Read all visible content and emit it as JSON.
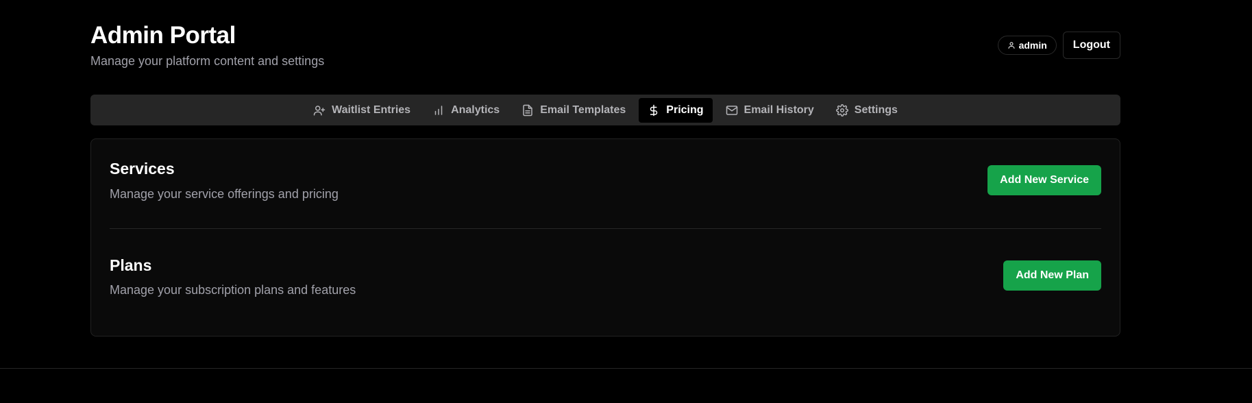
{
  "header": {
    "title": "Admin Portal",
    "subtitle": "Manage your platform content and settings",
    "user_label": "admin",
    "logout_label": "Logout"
  },
  "tabs": [
    {
      "label": "Waitlist Entries",
      "icon": "user-plus-icon",
      "active": false
    },
    {
      "label": "Analytics",
      "icon": "bar-chart-icon",
      "active": false
    },
    {
      "label": "Email Templates",
      "icon": "file-text-icon",
      "active": false
    },
    {
      "label": "Pricing",
      "icon": "dollar-icon",
      "active": true
    },
    {
      "label": "Email History",
      "icon": "mail-icon",
      "active": false
    },
    {
      "label": "Settings",
      "icon": "gear-icon",
      "active": false
    }
  ],
  "services": {
    "title": "Services",
    "description": "Manage your service offerings and pricing",
    "button_label": "Add New Service"
  },
  "plans": {
    "title": "Plans",
    "description": "Manage your subscription plans and features",
    "button_label": "Add New Plan"
  },
  "colors": {
    "background": "#000000",
    "accent_green": "#16a34a",
    "tab_bar": "#262626"
  }
}
